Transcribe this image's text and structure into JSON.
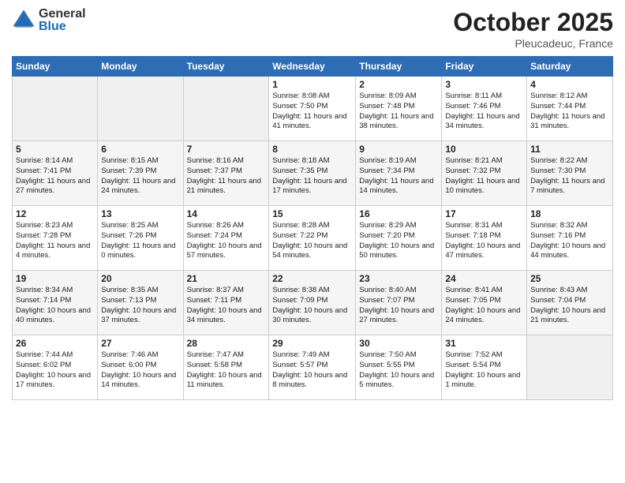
{
  "header": {
    "logo_general": "General",
    "logo_blue": "Blue",
    "month": "October 2025",
    "location": "Pleucadeuc, France"
  },
  "weekdays": [
    "Sunday",
    "Monday",
    "Tuesday",
    "Wednesday",
    "Thursday",
    "Friday",
    "Saturday"
  ],
  "weeks": [
    [
      {
        "day": "",
        "info": ""
      },
      {
        "day": "",
        "info": ""
      },
      {
        "day": "",
        "info": ""
      },
      {
        "day": "1",
        "info": "Sunrise: 8:08 AM\nSunset: 7:50 PM\nDaylight: 11 hours\nand 41 minutes."
      },
      {
        "day": "2",
        "info": "Sunrise: 8:09 AM\nSunset: 7:48 PM\nDaylight: 11 hours\nand 38 minutes."
      },
      {
        "day": "3",
        "info": "Sunrise: 8:11 AM\nSunset: 7:46 PM\nDaylight: 11 hours\nand 34 minutes."
      },
      {
        "day": "4",
        "info": "Sunrise: 8:12 AM\nSunset: 7:44 PM\nDaylight: 11 hours\nand 31 minutes."
      }
    ],
    [
      {
        "day": "5",
        "info": "Sunrise: 8:14 AM\nSunset: 7:41 PM\nDaylight: 11 hours\nand 27 minutes."
      },
      {
        "day": "6",
        "info": "Sunrise: 8:15 AM\nSunset: 7:39 PM\nDaylight: 11 hours\nand 24 minutes."
      },
      {
        "day": "7",
        "info": "Sunrise: 8:16 AM\nSunset: 7:37 PM\nDaylight: 11 hours\nand 21 minutes."
      },
      {
        "day": "8",
        "info": "Sunrise: 8:18 AM\nSunset: 7:35 PM\nDaylight: 11 hours\nand 17 minutes."
      },
      {
        "day": "9",
        "info": "Sunrise: 8:19 AM\nSunset: 7:34 PM\nDaylight: 11 hours\nand 14 minutes."
      },
      {
        "day": "10",
        "info": "Sunrise: 8:21 AM\nSunset: 7:32 PM\nDaylight: 11 hours\nand 10 minutes."
      },
      {
        "day": "11",
        "info": "Sunrise: 8:22 AM\nSunset: 7:30 PM\nDaylight: 11 hours\nand 7 minutes."
      }
    ],
    [
      {
        "day": "12",
        "info": "Sunrise: 8:23 AM\nSunset: 7:28 PM\nDaylight: 11 hours\nand 4 minutes."
      },
      {
        "day": "13",
        "info": "Sunrise: 8:25 AM\nSunset: 7:26 PM\nDaylight: 11 hours\nand 0 minutes."
      },
      {
        "day": "14",
        "info": "Sunrise: 8:26 AM\nSunset: 7:24 PM\nDaylight: 10 hours\nand 57 minutes."
      },
      {
        "day": "15",
        "info": "Sunrise: 8:28 AM\nSunset: 7:22 PM\nDaylight: 10 hours\nand 54 minutes."
      },
      {
        "day": "16",
        "info": "Sunrise: 8:29 AM\nSunset: 7:20 PM\nDaylight: 10 hours\nand 50 minutes."
      },
      {
        "day": "17",
        "info": "Sunrise: 8:31 AM\nSunset: 7:18 PM\nDaylight: 10 hours\nand 47 minutes."
      },
      {
        "day": "18",
        "info": "Sunrise: 8:32 AM\nSunset: 7:16 PM\nDaylight: 10 hours\nand 44 minutes."
      }
    ],
    [
      {
        "day": "19",
        "info": "Sunrise: 8:34 AM\nSunset: 7:14 PM\nDaylight: 10 hours\nand 40 minutes."
      },
      {
        "day": "20",
        "info": "Sunrise: 8:35 AM\nSunset: 7:13 PM\nDaylight: 10 hours\nand 37 minutes."
      },
      {
        "day": "21",
        "info": "Sunrise: 8:37 AM\nSunset: 7:11 PM\nDaylight: 10 hours\nand 34 minutes."
      },
      {
        "day": "22",
        "info": "Sunrise: 8:38 AM\nSunset: 7:09 PM\nDaylight: 10 hours\nand 30 minutes."
      },
      {
        "day": "23",
        "info": "Sunrise: 8:40 AM\nSunset: 7:07 PM\nDaylight: 10 hours\nand 27 minutes."
      },
      {
        "day": "24",
        "info": "Sunrise: 8:41 AM\nSunset: 7:05 PM\nDaylight: 10 hours\nand 24 minutes."
      },
      {
        "day": "25",
        "info": "Sunrise: 8:43 AM\nSunset: 7:04 PM\nDaylight: 10 hours\nand 21 minutes."
      }
    ],
    [
      {
        "day": "26",
        "info": "Sunrise: 7:44 AM\nSunset: 6:02 PM\nDaylight: 10 hours\nand 17 minutes."
      },
      {
        "day": "27",
        "info": "Sunrise: 7:46 AM\nSunset: 6:00 PM\nDaylight: 10 hours\nand 14 minutes."
      },
      {
        "day": "28",
        "info": "Sunrise: 7:47 AM\nSunset: 5:58 PM\nDaylight: 10 hours\nand 11 minutes."
      },
      {
        "day": "29",
        "info": "Sunrise: 7:49 AM\nSunset: 5:57 PM\nDaylight: 10 hours\nand 8 minutes."
      },
      {
        "day": "30",
        "info": "Sunrise: 7:50 AM\nSunset: 5:55 PM\nDaylight: 10 hours\nand 5 minutes."
      },
      {
        "day": "31",
        "info": "Sunrise: 7:52 AM\nSunset: 5:54 PM\nDaylight: 10 hours\nand 1 minute."
      },
      {
        "day": "",
        "info": ""
      }
    ]
  ]
}
